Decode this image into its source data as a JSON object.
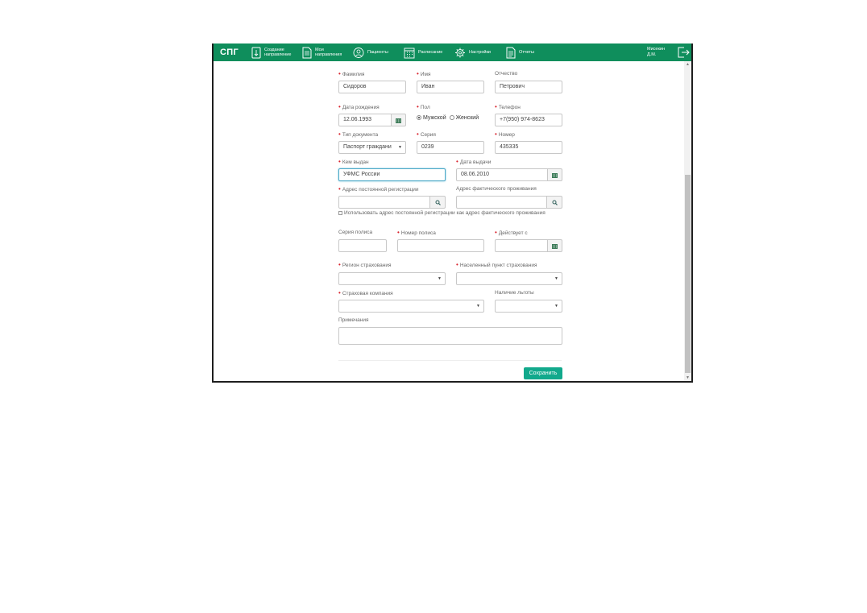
{
  "navbar": {
    "brand": "СПГ",
    "items": [
      {
        "label": "Создание\nнаправление"
      },
      {
        "label": "Мои\nнаправления"
      },
      {
        "label": "Пациенты"
      },
      {
        "label": "Расписание"
      },
      {
        "label": "Настройки"
      },
      {
        "label": "Отчеты"
      }
    ],
    "user": "Мисекин\nД.М."
  },
  "form": {
    "last_name": {
      "label": "Фамилия",
      "value": "Сидоров"
    },
    "first_name": {
      "label": "Имя",
      "value": "Иван"
    },
    "patronymic": {
      "label": "Отчество",
      "value": "Петрович"
    },
    "birth_date": {
      "label": "Дата рождения",
      "value": "12.06.1993"
    },
    "sex": {
      "label": "Пол",
      "options": [
        "Мужской",
        "Женский"
      ],
      "selected": "Мужской"
    },
    "phone": {
      "label": "Телефон",
      "value": "+7(950) 974-8623"
    },
    "doc_type": {
      "label": "Тип документа",
      "value": "Паспорт граждани"
    },
    "doc_series": {
      "label": "Серия",
      "value": "0239"
    },
    "doc_number": {
      "label": "Номер",
      "value": "435335"
    },
    "issued_by": {
      "label": "Кем выдан",
      "value": "УФМС России"
    },
    "issue_date": {
      "label": "Дата выдачи",
      "value": "08.06.2010"
    },
    "reg_address": {
      "label": "Адрес постоянной регистрации",
      "value": ""
    },
    "actual_address": {
      "label": "Адрес фактического проживания",
      "value": ""
    },
    "use_reg_address": {
      "label": "Использовать адрес постоянной регистрации как адрес фактического проживания",
      "checked": false
    },
    "policy_series": {
      "label": "Серия полиса",
      "value": ""
    },
    "policy_number": {
      "label": "Номер полиса",
      "value": ""
    },
    "valid_from": {
      "label": "Действует с",
      "value": ""
    },
    "insurance_region": {
      "label": "Регион страхования",
      "value": ""
    },
    "insurance_locality": {
      "label": "Населенный пункт страхования",
      "value": ""
    },
    "insurance_company": {
      "label": "Страховая компания",
      "value": ""
    },
    "benefit": {
      "label": "Наличие льготы",
      "value": ""
    },
    "notes": {
      "label": "Примечания",
      "value": ""
    },
    "save_label": "Сохранить"
  },
  "colors": {
    "navbar": "#0f8e5c",
    "save_button": "#12a98c",
    "required": "#d9232d"
  }
}
